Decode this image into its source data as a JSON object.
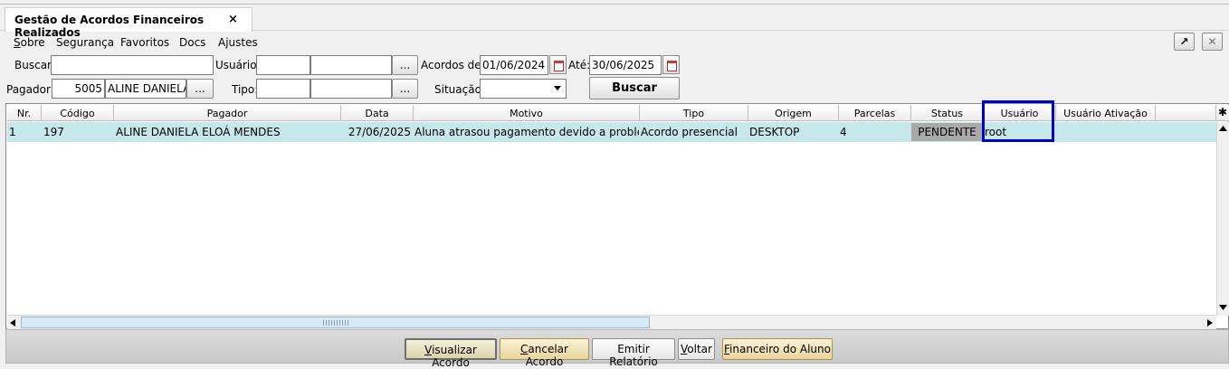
{
  "tab": {
    "title": "Gestão de Acordos Financeiros Realizados",
    "close_icon": "×"
  },
  "menu": [
    {
      "pre": "",
      "key": "S",
      "post": "obre"
    },
    {
      "pre": "Segurança",
      "key": "",
      "post": ""
    },
    {
      "pre": "Favoritos",
      "key": "",
      "post": ""
    },
    {
      "pre": "Docs",
      "key": "",
      "post": ""
    },
    {
      "pre": "Ajustes",
      "key": "",
      "post": ""
    }
  ],
  "window_controls": {
    "detach_icon": "↗",
    "close_icon": "✕"
  },
  "filters": {
    "buscar_label": "Buscar:",
    "buscar_value": "",
    "usuario_label": "Usuário:",
    "usuario_code": "",
    "usuario_name": "",
    "acordos_de_label": "Acordos de:",
    "acordos_de_value": "01/06/2024",
    "ate_label": "Até:",
    "ate_value": "30/06/2025",
    "pagador_label": "Pagador:",
    "pagador_code": "5005",
    "pagador_name": "ALINE DANIELA",
    "tipo_label": "Tipo:",
    "tipo_code": "",
    "tipo_name": "",
    "situacao_label": "Situação:",
    "situacao_value": "",
    "lookup_label": "...",
    "buscar_button": "Buscar"
  },
  "table": {
    "columns": [
      "Nr.",
      "Código",
      "Pagador",
      "Data",
      "Motivo",
      "Tipo",
      "Origem",
      "Parcelas",
      "Status",
      "Usuário",
      "Usuário Ativação"
    ],
    "rows": [
      {
        "nr": "1",
        "codigo": "197",
        "pagador": "ALINE DANIELA ELOÁ MENDES",
        "data": "27/06/2025",
        "motivo": "Aluna atrasou pagamento devido a problem...",
        "tipo": "Acordo presencial",
        "origem": "DESKTOP",
        "parcelas": "4",
        "status": "PENDENTE",
        "usuario": "root",
        "usuario_ativacao": ""
      }
    ],
    "highlight_color": "#0000cc",
    "status_pending_color": "#a9a9a9",
    "row_selected_color": "#c6e8ea"
  },
  "actions": {
    "visualizar": {
      "pre": "",
      "key": "V",
      "post": "isualizar Acordo"
    },
    "cancelar": {
      "pre": "",
      "key": "C",
      "post": "ancelar Acordo"
    },
    "emitir": "Emitir Relatório",
    "voltar": {
      "pre": "",
      "key": "V",
      "post": "oltar"
    },
    "financeiro": {
      "pre": "",
      "key": "F",
      "post": "inanceiro do Aluno"
    }
  }
}
